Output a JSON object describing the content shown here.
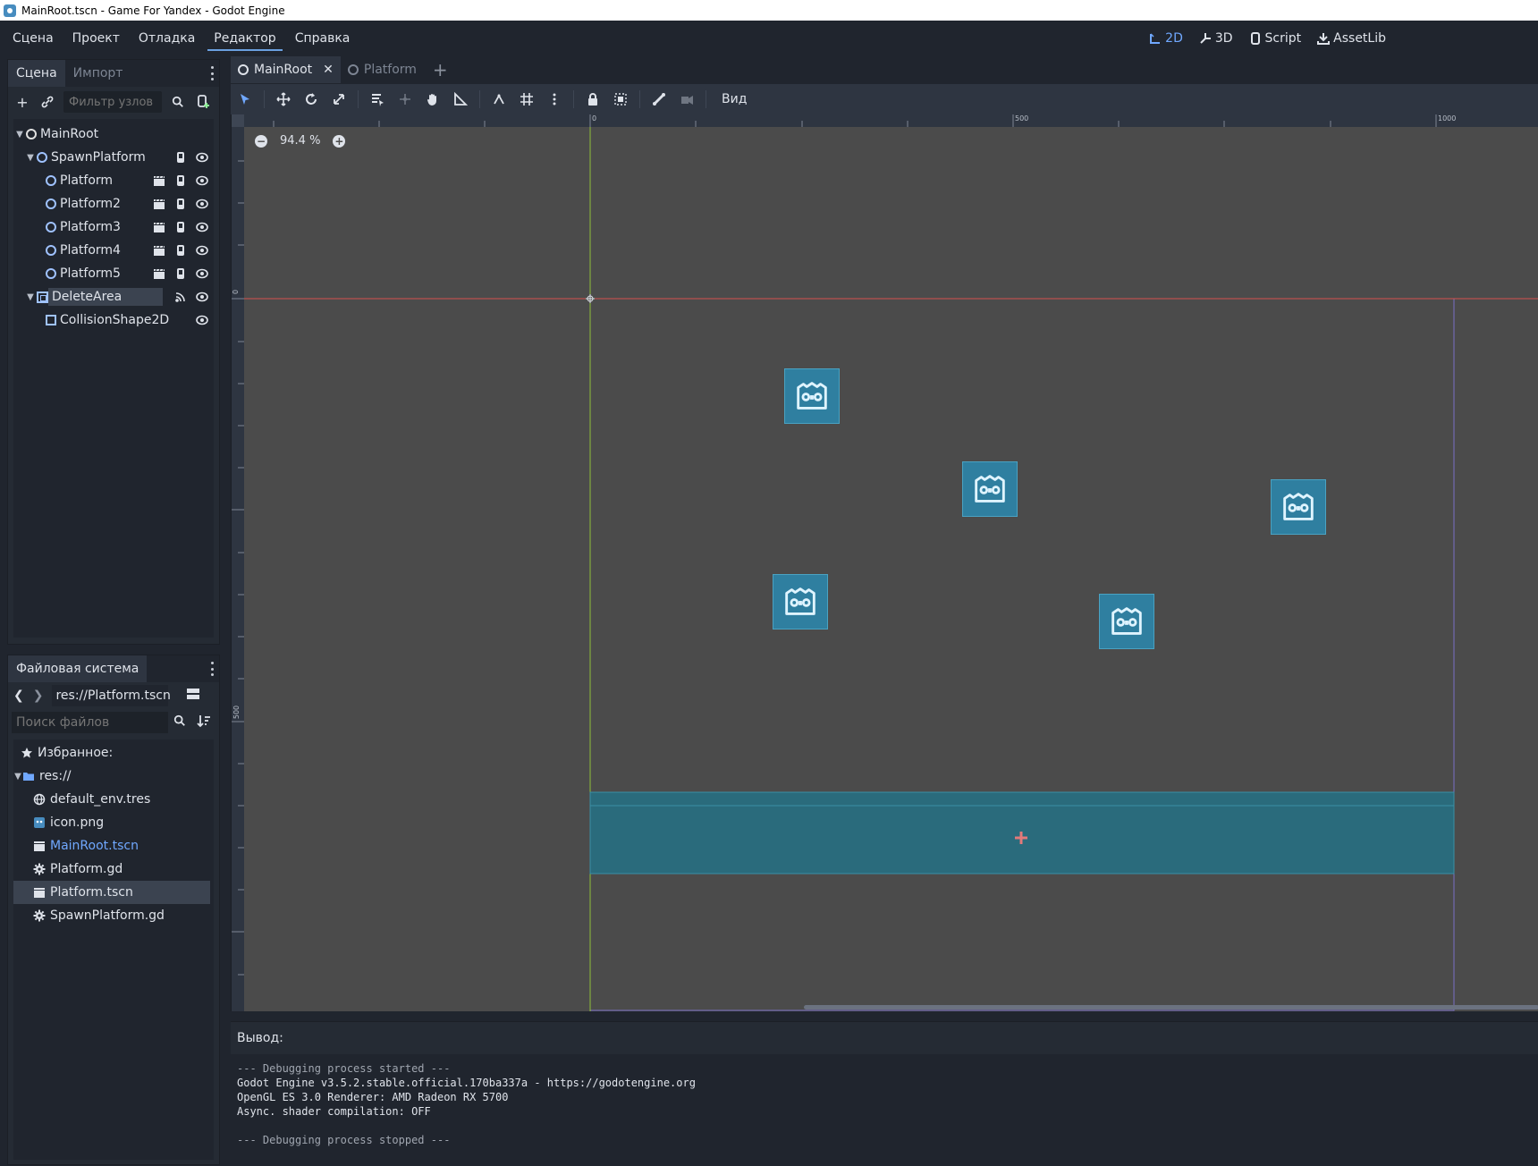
{
  "window": {
    "title": "MainRoot.tscn - Game For Yandex - Godot Engine"
  },
  "menu": {
    "items": [
      "Сцена",
      "Проект",
      "Отладка",
      "Редактор",
      "Справка"
    ],
    "active_index": 3
  },
  "workspaces": [
    {
      "label": "2D",
      "icon": "2d-icon",
      "active": true
    },
    {
      "label": "3D",
      "icon": "3d-icon",
      "active": false
    },
    {
      "label": "Script",
      "icon": "script-icon",
      "active": false
    },
    {
      "label": "AssetLib",
      "icon": "assetlib-icon",
      "active": false
    }
  ],
  "scene_dock": {
    "tabs": [
      "Сцена",
      "Импорт"
    ],
    "filter_placeholder": "Фильтр узлов",
    "nodes": [
      {
        "name": "MainRoot",
        "type": "node2d",
        "depth": 0,
        "expanded": true
      },
      {
        "name": "SpawnPlatform",
        "type": "node2d",
        "depth": 1,
        "expanded": true
      },
      {
        "name": "Platform",
        "type": "node2d",
        "depth": 2
      },
      {
        "name": "Platform2",
        "type": "node2d",
        "depth": 2
      },
      {
        "name": "Platform3",
        "type": "node2d",
        "depth": 2
      },
      {
        "name": "Platform4",
        "type": "node2d",
        "depth": 2
      },
      {
        "name": "Platform5",
        "type": "node2d",
        "depth": 2
      },
      {
        "name": "DeleteArea",
        "type": "area2d",
        "depth": 1,
        "expanded": true,
        "selected": true
      },
      {
        "name": "CollisionShape2D",
        "type": "collision",
        "depth": 2
      }
    ]
  },
  "filesystem_dock": {
    "title": "Файловая система",
    "path": "res://Platform.tscn",
    "search_placeholder": "Поиск файлов",
    "favorites_label": "Избранное:",
    "root_label": "res://",
    "files": [
      {
        "name": "default_env.tres",
        "icon": "environment-icon"
      },
      {
        "name": "icon.png",
        "icon": "image-icon"
      },
      {
        "name": "MainRoot.tscn",
        "icon": "scene-icon",
        "current": true
      },
      {
        "name": "Platform.gd",
        "icon": "gear-icon"
      },
      {
        "name": "Platform.tscn",
        "icon": "scene-icon",
        "selected": true
      },
      {
        "name": "SpawnPlatform.gd",
        "icon": "gear-icon"
      }
    ]
  },
  "scene_tabs": [
    {
      "label": "MainRoot",
      "active": true
    },
    {
      "label": "Platform",
      "active": false
    }
  ],
  "canvas_toolbar": {
    "view_label": "Вид"
  },
  "viewport": {
    "zoom": "94.4 %",
    "ruler_top_labels": [
      "0",
      "500",
      "1000"
    ],
    "ruler_left_labels": [
      "0",
      "500"
    ]
  },
  "output": {
    "title": "Вывод:",
    "lines": [
      "--- Debugging process started ---",
      "Godot Engine v3.5.2.stable.official.170ba337a - https://godotengine.org",
      "OpenGL ES 3.0 Renderer: AMD Radeon RX 5700",
      "Async. shader compilation: OFF",
      "",
      "--- Debugging process stopped ---"
    ]
  },
  "colors": {
    "accent": "#70a8ff",
    "panel_bg": "#252b34",
    "viewport_bg": "#4b4b4b",
    "area_fill": "#2a6b7c",
    "sprite_bg": "#2f7fa0"
  }
}
